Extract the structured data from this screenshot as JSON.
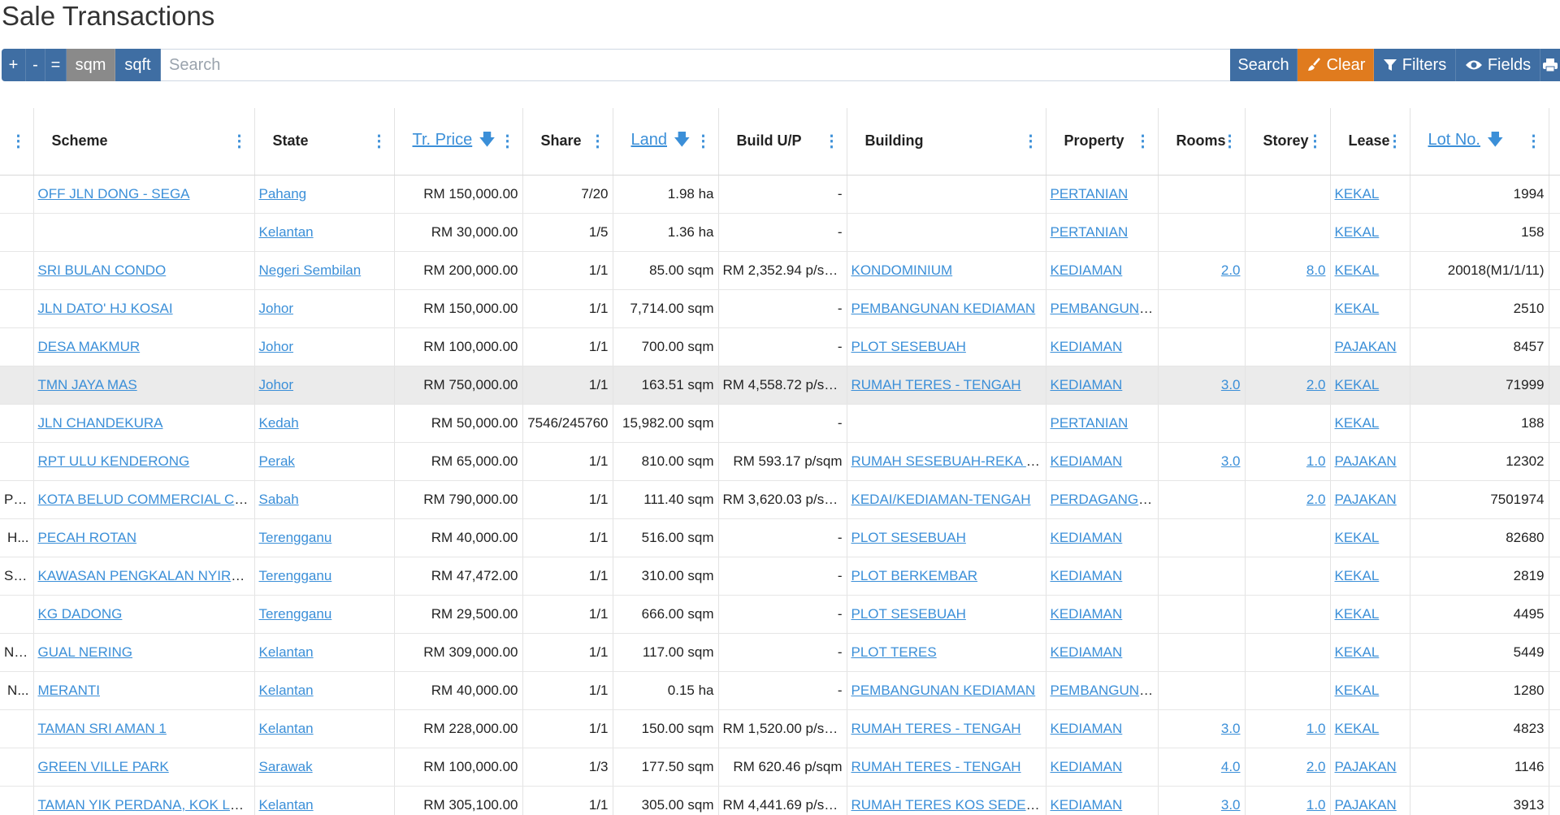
{
  "title": "Sale Transactions",
  "toolbar": {
    "plus": "+",
    "minus": "-",
    "equals": "=",
    "sqm": "sqm",
    "sqft": "sqft",
    "search_placeholder": "Search",
    "search_button": "Search",
    "clear_button": "Clear",
    "filters_button": "Filters",
    "fields_button": "Fields"
  },
  "colors": {
    "toolbar_blue": "#3f6ea3",
    "toolbar_grey": "#8a8a8a",
    "clear_orange": "#e07b1e",
    "link_blue": "#3b8fd8"
  },
  "columns": {
    "scheme": "Scheme",
    "state": "State",
    "price": "Tr. Price",
    "share": "Share",
    "land": "Land",
    "build": "Build U/P",
    "building": "Building",
    "property": "Property",
    "rooms": "Rooms",
    "storey": "Storey",
    "lease": "Lease",
    "lot": "Lot No."
  },
  "rows": [
    {
      "left": "",
      "scheme": "OFF JLN DONG - SEGA",
      "state": "Pahang",
      "price": "RM 150,000.00",
      "share": "7/20",
      "land": "1.98 ha",
      "build": "-",
      "building": "",
      "property": "PERTANIAN",
      "rooms": "",
      "storey": "",
      "lease": "KEKAL",
      "lot": "1994"
    },
    {
      "left": "",
      "scheme": "",
      "state": "Kelantan",
      "price": "RM 30,000.00",
      "share": "1/5",
      "land": "1.36 ha",
      "build": "-",
      "building": "",
      "property": "PERTANIAN",
      "rooms": "",
      "storey": "",
      "lease": "KEKAL",
      "lot": "158"
    },
    {
      "left": "",
      "scheme": "SRI BULAN CONDO",
      "state": "Negeri Sembilan",
      "price": "RM 200,000.00",
      "share": "1/1",
      "land": "85.00 sqm",
      "build": "RM 2,352.94 p/sqm",
      "building": "KONDOMINIUM",
      "property": "KEDIAMAN",
      "rooms": "2.0",
      "storey": "8.0",
      "lease": "KEKAL",
      "lot": "20018(M1/1/11)"
    },
    {
      "left": "",
      "scheme": "JLN DATO' HJ KOSAI",
      "state": "Johor",
      "price": "RM 150,000.00",
      "share": "1/1",
      "land": "7,714.00 sqm",
      "build": "-",
      "building": "PEMBANGUNAN KEDIAMAN",
      "property": "PEMBANGUNAN",
      "rooms": "",
      "storey": "",
      "lease": "KEKAL",
      "lot": "2510"
    },
    {
      "left": "",
      "scheme": "DESA MAKMUR",
      "state": "Johor",
      "price": "RM 100,000.00",
      "share": "1/1",
      "land": "700.00 sqm",
      "build": "-",
      "building": "PLOT SESEBUAH",
      "property": "KEDIAMAN",
      "rooms": "",
      "storey": "",
      "lease": "PAJAKAN",
      "lot": "8457"
    },
    {
      "left": "",
      "scheme": "TMN JAYA MAS",
      "state": "Johor",
      "price": "RM 750,000.00",
      "share": "1/1",
      "land": "163.51 sqm",
      "build": "RM 4,558.72 p/sqm",
      "building": "RUMAH TERES - TENGAH",
      "property": "KEDIAMAN",
      "rooms": "3.0",
      "storey": "2.0",
      "lease": "KEKAL",
      "lot": "71999"
    },
    {
      "left": "",
      "scheme": "JLN CHANDEKURA",
      "state": "Kedah",
      "price": "RM 50,000.00",
      "share": "7546/245760",
      "land": "15,982.00 sqm",
      "build": "-",
      "building": "",
      "property": "PERTANIAN",
      "rooms": "",
      "storey": "",
      "lease": "KEKAL",
      "lot": "188"
    },
    {
      "left": "",
      "scheme": "RPT ULU KENDERONG",
      "state": "Perak",
      "price": "RM 65,000.00",
      "share": "1/1",
      "land": "810.00 sqm",
      "build": "RM 593.17 p/sqm",
      "building": "RUMAH SESEBUAH-REKA BENTUK",
      "property": "KEDIAMAN",
      "rooms": "3.0",
      "storey": "1.0",
      "lease": "PAJAKAN",
      "lot": "12302"
    },
    {
      "left": "PE...",
      "scheme": "KOTA BELUD COMMERCIAL CENTRE",
      "state": "Sabah",
      "price": "RM 790,000.00",
      "share": "1/1",
      "land": "111.40 sqm",
      "build": "RM 3,620.03 p/sqm",
      "building": "KEDAI/KEDIAMAN-TENGAH",
      "property": "PERDAGANGAN",
      "rooms": "",
      "storey": "2.0",
      "lease": "PAJAKAN",
      "lot": "7501974"
    },
    {
      "left": "H...",
      "scheme": "PECAH ROTAN",
      "state": "Terengganu",
      "price": "RM 40,000.00",
      "share": "1/1",
      "land": "516.00 sqm",
      "build": "-",
      "building": "PLOT SESEBUAH",
      "property": "KEDIAMAN",
      "rooms": "",
      "storey": "",
      "lease": "KEKAL",
      "lot": "82680"
    },
    {
      "left": "SE...",
      "scheme": "KAWASAN PENGKALAN NYIREH",
      "state": "Terengganu",
      "price": "RM 47,472.00",
      "share": "1/1",
      "land": "310.00 sqm",
      "build": "-",
      "building": "PLOT BERKEMBAR",
      "property": "KEDIAMAN",
      "rooms": "",
      "storey": "",
      "lease": "KEKAL",
      "lot": "2819"
    },
    {
      "left": "",
      "scheme": "KG DADONG",
      "state": "Terengganu",
      "price": "RM 29,500.00",
      "share": "1/1",
      "land": "666.00 sqm",
      "build": "-",
      "building": "PLOT SESEBUAH",
      "property": "KEDIAMAN",
      "rooms": "",
      "storey": "",
      "lease": "KEKAL",
      "lot": "4495"
    },
    {
      "left": "NT...",
      "scheme": "GUAL NERING",
      "state": "Kelantan",
      "price": "RM 309,000.00",
      "share": "1/1",
      "land": "117.00 sqm",
      "build": "-",
      "building": "PLOT TERES",
      "property": "KEDIAMAN",
      "rooms": "",
      "storey": "",
      "lease": "KEKAL",
      "lot": "5449"
    },
    {
      "left": "N...",
      "scheme": "MERANTI",
      "state": "Kelantan",
      "price": "RM 40,000.00",
      "share": "1/1",
      "land": "0.15 ha",
      "build": "-",
      "building": "PEMBANGUNAN KEDIAMAN",
      "property": "PEMBANGUNAN",
      "rooms": "",
      "storey": "",
      "lease": "KEKAL",
      "lot": "1280"
    },
    {
      "left": "",
      "scheme": "TAMAN SRI AMAN 1",
      "state": "Kelantan",
      "price": "RM 228,000.00",
      "share": "1/1",
      "land": "150.00 sqm",
      "build": "RM 1,520.00 p/sqm",
      "building": "RUMAH TERES - TENGAH",
      "property": "KEDIAMAN",
      "rooms": "3.0",
      "storey": "1.0",
      "lease": "KEKAL",
      "lot": "4823"
    },
    {
      "left": "",
      "scheme": "GREEN VILLE PARK",
      "state": "Sarawak",
      "price": "RM 100,000.00",
      "share": "1/3",
      "land": "177.50 sqm",
      "build": "RM 620.46 p/sqm",
      "building": "RUMAH TERES - TENGAH",
      "property": "KEDIAMAN",
      "rooms": "4.0",
      "storey": "2.0",
      "lease": "PAJAKAN",
      "lot": "1146"
    },
    {
      "left": "",
      "scheme": "TAMAN YIK PERDANA, KOK LANAS",
      "state": "Kelantan",
      "price": "RM 305,100.00",
      "share": "1/1",
      "land": "305.00 sqm",
      "build": "RM 4,441.69 p/sqm",
      "building": "RUMAH TERES KOS SEDERHANA",
      "property": "KEDIAMAN",
      "rooms": "3.0",
      "storey": "1.0",
      "lease": "PAJAKAN",
      "lot": "3913"
    }
  ]
}
